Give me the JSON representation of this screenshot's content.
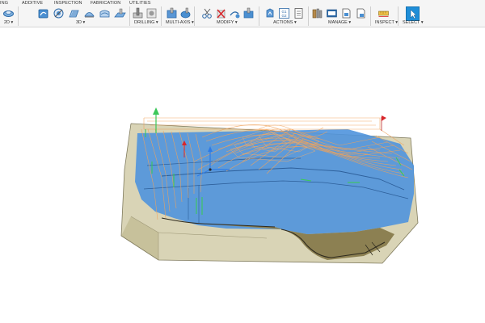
{
  "tabs": [
    "ING",
    "ADDITIVE",
    "INSPECTION",
    "FABRICATION",
    "UTILITIES"
  ],
  "groups": {
    "g2d": "2D ▾",
    "g3d": "3D ▾",
    "drilling": "DRILLING ▾",
    "multiaxis": "MULTI-AXIS ▾",
    "modify": "MODIFY ▾",
    "actions": "ACTIONS ▾",
    "manage": "MANAGE ▾",
    "inspect": "INSPECT ▾",
    "select": "SELECT ▾"
  },
  "icons": {
    "actions_g1": "G1",
    "actions_g2": "G2"
  },
  "left_panel": {
    "mini_button": "⚙",
    "corner_number": "2"
  },
  "colors": {
    "accent_blue": "#1f8ed8",
    "part_blue": "#4f94dd",
    "stock": "#c9c39d",
    "toolpath": "#f0a25a",
    "green_marker": "#3cc85a",
    "red_marker": "#d8262b"
  }
}
